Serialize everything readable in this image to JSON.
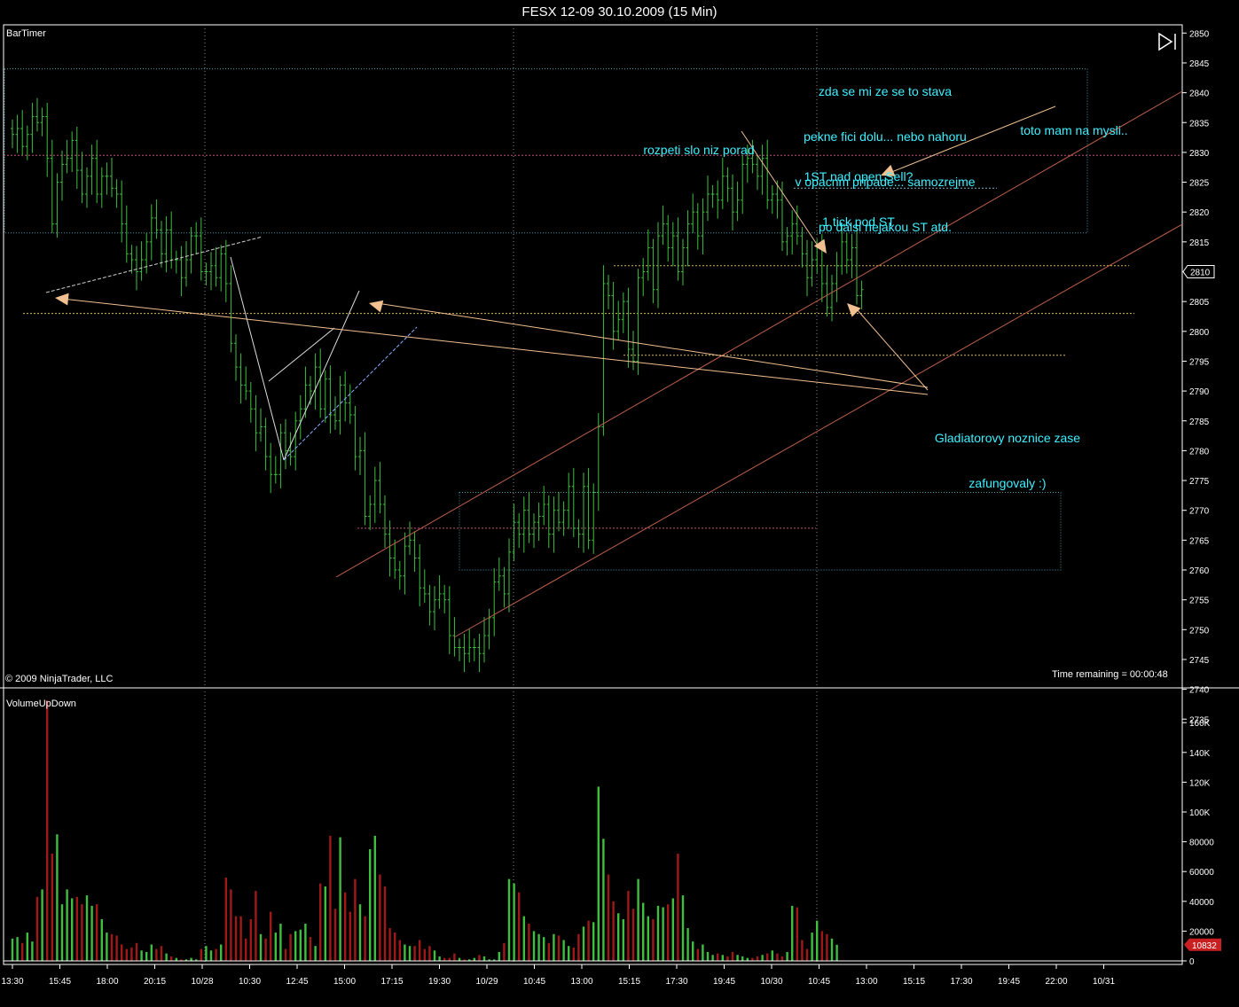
{
  "window": {
    "title": "FESX 12-09  30.10.2009 (15 Min)",
    "indicator_main": "BarTimer",
    "indicator_sub": "VolumeUpDown",
    "copyright": "© 2009 NinjaTrader, LLC",
    "time_remaining": "Time remaining = 00:00:48",
    "price_marker": "2810",
    "volume_marker": "10832",
    "play_icon": "next-bar-icon"
  },
  "annotations": {
    "a1": [
      "zda se mi ze se to stava",
      "pekne fici dolu... nebo nahoru",
      "v opacnm pripade... samozrejme",
      "po dalsi nejakou ST atd."
    ],
    "a2": [
      "toto mam na mysli.."
    ],
    "a3": [
      "rozpeti slo niz porad"
    ],
    "a4": [
      "1ST nad open Sell?",
      "1 tick pod ST"
    ],
    "a5": [
      "Gladiatorovy noznice zase",
      "zafungovaly :)"
    ]
  },
  "colors": {
    "up_bar": "#3fbf3f",
    "down_bar": "#a01818",
    "annotation": "#3ff0ff",
    "trend": "#c0604a",
    "arrow": "#f0c090"
  },
  "chart_data": [
    {
      "type": "ohlc",
      "title": "FESX 12-09  30.10.2009 (15 Min)",
      "ylim": [
        2732,
        2851
      ],
      "y_ticks": [
        2735,
        2740,
        2745,
        2750,
        2755,
        2760,
        2765,
        2770,
        2775,
        2780,
        2785,
        2790,
        2795,
        2800,
        2805,
        2810,
        2815,
        2820,
        2825,
        2830,
        2835,
        2840,
        2845,
        2850
      ],
      "x_ticks": [
        "13:30",
        "15:45",
        "18:00",
        "20:15",
        "10/28",
        "10:30",
        "12:45",
        "15:00",
        "17:15",
        "19:30",
        "10/29",
        "10:45",
        "13:00",
        "15:15",
        "17:30",
        "19:45",
        "10/30",
        "10:45",
        "13:00",
        "15:15",
        "17:30",
        "19:45",
        "22:00",
        "10/31"
      ],
      "last_price": 2810,
      "closes": [
        2833,
        2834,
        2831,
        2833,
        2836,
        2835,
        2836,
        2829,
        2818,
        2825,
        2828,
        2829,
        2832,
        2827,
        2823,
        2826,
        2829,
        2823,
        2826,
        2826,
        2824,
        2823,
        2818,
        2813,
        2812,
        2810,
        2812,
        2815,
        2819,
        2817,
        2813,
        2817,
        2812,
        2812,
        2809,
        2812,
        2816,
        2816,
        2810,
        2810,
        2811,
        2809,
        2813,
        2808,
        2798,
        2794,
        2791,
        2790,
        2787,
        2783,
        2784,
        2779,
        2776,
        2776,
        2783,
        2780,
        2779,
        2785,
        2787,
        2791,
        2790,
        2794,
        2787,
        2792,
        2786,
        2785,
        2791,
        2788,
        2786,
        2779,
        2780,
        2769,
        2771,
        2775,
        2771,
        2766,
        2762,
        2760,
        2759,
        2764,
        2765,
        2762,
        2757,
        2756,
        2753,
        2755,
        2756,
        2755,
        2749,
        2747,
        2747,
        2746,
        2747,
        2747,
        2746,
        2749,
        2752,
        2758,
        2759,
        2756,
        2763,
        2768,
        2766,
        2770,
        2766,
        2768,
        2769,
        2771,
        2766,
        2770,
        2768,
        2770,
        2774,
        2767,
        2766,
        2774,
        2765,
        2773,
        2784,
        2808,
        2806,
        2800,
        2802,
        2805,
        2797,
        2795,
        2809,
        2810,
        2814,
        2807,
        2816,
        2818,
        2814,
        2816,
        2810,
        2814,
        2818,
        2820,
        2816,
        2820,
        2823,
        2823,
        2822,
        2826,
        2824,
        2820,
        2822,
        2828,
        2829,
        2828,
        2826,
        2829,
        2822,
        2823,
        2822,
        2815,
        2816,
        2818,
        2816,
        2813,
        2809,
        2812,
        2814,
        2808,
        2804,
        2808,
        2811,
        2815,
        2812,
        2814,
        2806,
        2807
      ],
      "ylabel": ""
    },
    {
      "type": "bar",
      "title": "VolumeUpDown",
      "ylim": [
        0,
        175000
      ],
      "y_ticks": [
        0,
        20000,
        40000,
        60000,
        80000,
        100000,
        120000,
        140000,
        160000
      ],
      "y_tick_labels": [
        "0",
        "20000",
        "40000",
        "60000",
        "80000",
        "100K",
        "120K",
        "140K",
        "160K"
      ],
      "last_value": 10832,
      "volumes": [
        15000,
        16000,
        12000,
        19000,
        13000,
        43000,
        48000,
        175000,
        72000,
        85000,
        38000,
        48000,
        42000,
        43000,
        38000,
        44000,
        37000,
        38000,
        28000,
        19000,
        18000,
        17000,
        11000,
        8000,
        9000,
        12000,
        7000,
        6000,
        11000,
        8000,
        10000,
        5000,
        3000,
        2000,
        1000,
        1000,
        2000,
        1000,
        8000,
        10000,
        7000,
        8000,
        11000,
        56000,
        48000,
        30000,
        30000,
        15000,
        28000,
        47000,
        18000,
        15000,
        33000,
        19000,
        25000,
        8000,
        18000,
        20000,
        21000,
        25000,
        16000,
        10000,
        52000,
        50000,
        84000,
        35000,
        83000,
        46000,
        33000,
        55000,
        38000,
        30000,
        75000,
        84000,
        58000,
        50000,
        22000,
        19000,
        14000,
        11000,
        10000,
        10000,
        14000,
        8000,
        10000,
        7000,
        3000,
        2000,
        2000,
        5000,
        2000,
        1000,
        1000,
        2000,
        4000,
        3000,
        1000,
        1000,
        6000,
        12000,
        55000,
        52000,
        46000,
        30000,
        25000,
        20000,
        18000,
        16000,
        12000,
        18000,
        17000,
        14000,
        10000,
        9000,
        18000,
        23000,
        27000,
        26000,
        117000,
        82000,
        58000,
        40000,
        32000,
        28000,
        47000,
        35000,
        55000,
        39000,
        30000,
        28000,
        37000,
        36000,
        38000,
        42000,
        72000,
        44000,
        22000,
        13000,
        8000,
        11000,
        6000,
        4000,
        5000,
        4000,
        3000,
        6000,
        4000,
        3000,
        2000,
        2000,
        3000,
        4000,
        5000,
        7000,
        5000,
        3000,
        6000,
        37000,
        36000,
        14000,
        8000,
        19000,
        27000,
        20000,
        18000,
        15000,
        10832
      ],
      "ylabel": ""
    }
  ]
}
